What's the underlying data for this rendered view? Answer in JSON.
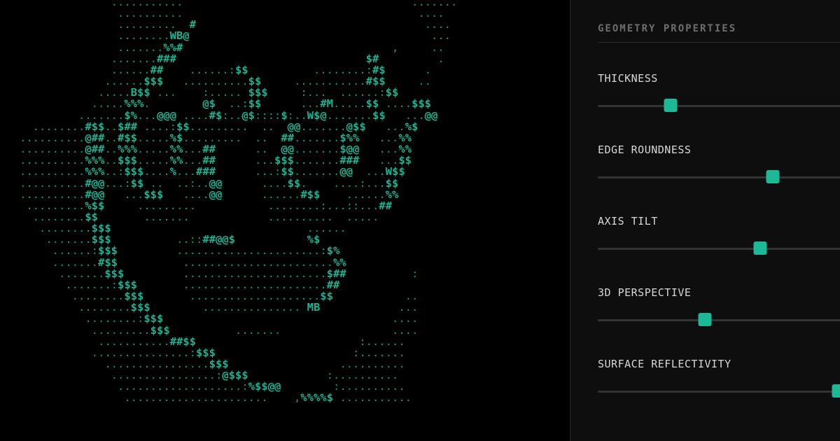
{
  "ascii_art": {
    "lines": [
      "                 ...........                                   .......",
      "                  ..........                                    ....",
      "                  .........  #                                   ....",
      "                  ........WB@                                     ...",
      "                  .......%%#                                ,     ..",
      "                 .......###                             $#         .",
      "                 ......##    ......:$$          ........:#$      .",
      "                ......$$$   ..........$$     ...........#$$     ..",
      "               .....B$$ ...    :..... $$$     :...  ......:$$",
      "              .....%%%.        @$  ..:$$      ...#M.....$$ ....$$$",
      "            .......$%...@@@ ....#$:..@$::::$:..W$@.......$$   ...@@",
      "     ........#$$..$## ....:$$.........  ..  @@.......@$$   ...%$",
      "   ..........@##..#$$.....%$.........  ..  ##.......$%%   ...%%",
      "   ..........@##..%%%.....%%...##      ..  @@.......$@@   ...%%",
      "   ..........%%%..$$$.....%%...##      ...$$$.......###   ...$$",
      "   ..........%%%..:$$$....%...###      ...:$$.......@@  ...W$$",
      "   ..........#@@...:$$ ..  ..:..@@      ....$$.    ....:...$$",
      "   ..........#@@   ...$$$   ....@@      ......#$$    ......%%",
      "    .........%$$     .........           ........:...::...##",
      "     ........$$       .......            ..........  .....",
      "      ........$$$                              ......",
      "       .......$$$          ..::##@@$           %$",
      "        ......:$$$         ......................:$%",
      "        .......#$$          .......................%%",
      "         .......$$$         ......................$##          :",
      "          .......:$$$       ......................##",
      "           ........$$$       ....................$$           ..",
      "            ........$$$        ............... MB            ...",
      "             ........:$$$                                   ....",
      "              .........$$$          .......                 ....",
      "               ...........##$$                         :......",
      "              ...............:$$$                     :.......",
      "                ................$$$                 ..........",
      "                 ................:@$$$            :..........",
      "                  ...................:%$$@@        :..........",
      "                   ......................    ,%%%%$ ..........."
    ]
  },
  "panel": {
    "title": "GEOMETRY PROPERTIES",
    "accent_color": "#1db895",
    "properties": [
      {
        "label": "THICKNESS",
        "value": 0.3
      },
      {
        "label": "EDGE ROUNDNESS",
        "value": 0.72
      },
      {
        "label": "AXIS TILT",
        "value": 0.67
      },
      {
        "label": "3D PERSPECTIVE",
        "value": 0.44
      },
      {
        "label": "SURFACE REFLECTIVITY",
        "value": 0.99
      }
    ]
  }
}
